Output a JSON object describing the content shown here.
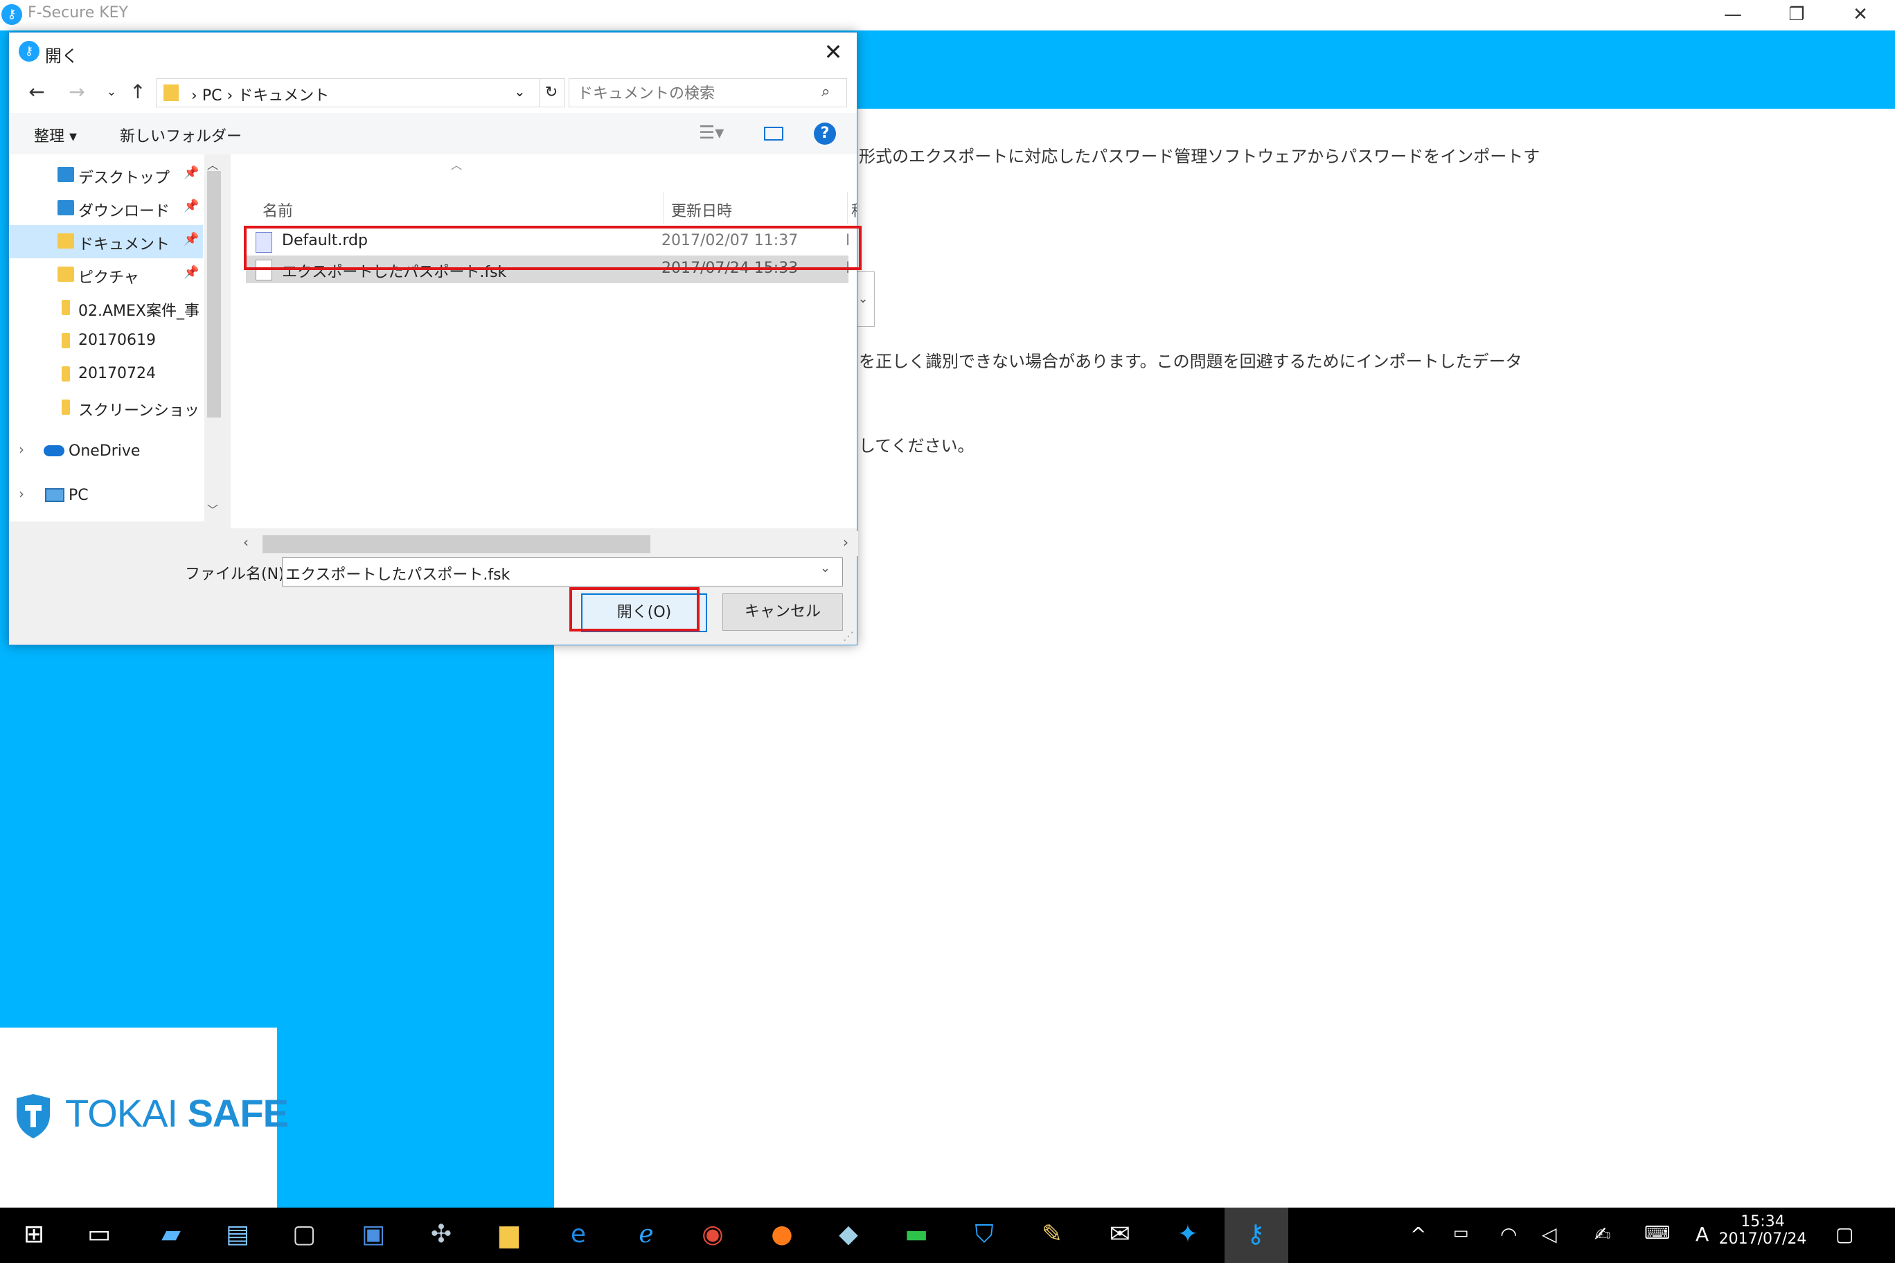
{
  "app": {
    "title": "F-Secure KEY",
    "icon": "key-icon"
  },
  "window_controls": {
    "minimize": "—",
    "restore": "❐",
    "close": "✕"
  },
  "content": {
    "line1": "形式のエクスポートに対応したパスワード管理ソフトウェアからパスワードをインポートす",
    "line2": "を正しく識別できない場合があります。この問題を回避するためにインポートしたデータ",
    "line3": "してください。"
  },
  "logo": {
    "text_thin": "TOKAI",
    "text_bold": "SAFE"
  },
  "dialog": {
    "title": "開く",
    "address": {
      "path_pc": "PC",
      "path_folder": "ドキュメント",
      "separator": "›"
    },
    "search": {
      "placeholder": "ドキュメントの検索"
    },
    "toolbar": {
      "organize": "整理 ▾",
      "new_folder": "新しいフォルダー"
    },
    "nav": [
      {
        "label": "デスクトップ",
        "pin": "📌"
      },
      {
        "label": "ダウンロード",
        "pin": "📌"
      },
      {
        "label": "ドキュメント",
        "pin": "📌"
      },
      {
        "label": "ピクチャ",
        "pin": "📌"
      },
      {
        "label": "02.AMEX案件_事"
      },
      {
        "label": "20170619"
      },
      {
        "label": "20170724"
      },
      {
        "label": "スクリーンショット"
      },
      {
        "label": "OneDrive"
      },
      {
        "label": "PC"
      }
    ],
    "columns": {
      "name": "名前",
      "date": "更新日時",
      "type": "種"
    },
    "files": [
      {
        "name": "Default.rdp",
        "date": "2017/02/07 11:37",
        "type": "I"
      },
      {
        "name": "エクスポートしたパスポート.fsk",
        "date": "2017/07/24 15:33",
        "type": "F"
      }
    ],
    "filename_label": "ファイル名(N):",
    "filename_value": "エクスポートしたパスポート.fsk",
    "open_button": "開く(O)",
    "cancel_button": "キャンセル"
  },
  "taskbar": {
    "time": "15:34",
    "date": "2017/07/24",
    "ime": "A"
  },
  "colors": {
    "accent": "#00b4ff",
    "highlight": "#e0161b",
    "selection": "#cce8ff"
  }
}
